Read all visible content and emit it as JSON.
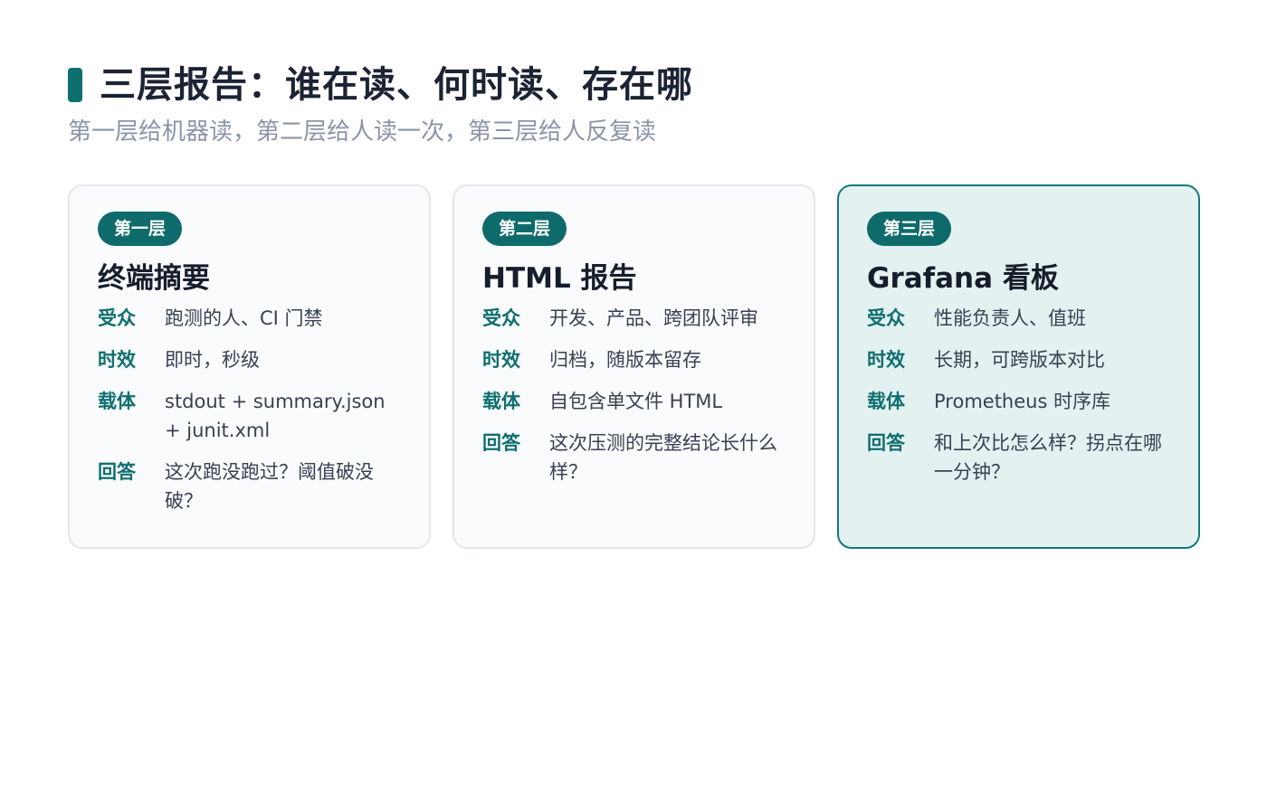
{
  "header": {
    "title": "三层报告：谁在读、何时读、存在哪",
    "subtitle": "第一层给机器读，第二层给人读一次，第三层给人反复读"
  },
  "cards": [
    {
      "badge": "第一层",
      "title": "终端摘要",
      "rows": [
        {
          "label": "受众",
          "value": "跑测的人、CI 门禁"
        },
        {
          "label": "时效",
          "value": "即时，秒级"
        },
        {
          "label": "载体",
          "value": "stdout + summary.json + junit.xml"
        },
        {
          "label": "回答",
          "value": "这次跑没跑过？阈值破没破？"
        }
      ]
    },
    {
      "badge": "第二层",
      "title": "HTML 报告",
      "rows": [
        {
          "label": "受众",
          "value": "开发、产品、跨团队评审"
        },
        {
          "label": "时效",
          "value": "归档，随版本留存"
        },
        {
          "label": "载体",
          "value": "自包含单文件 HTML"
        },
        {
          "label": "回答",
          "value": "这次压测的完整结论长什么样？"
        }
      ]
    },
    {
      "badge": "第三层",
      "title": "Grafana 看板",
      "rows": [
        {
          "label": "受众",
          "value": "性能负责人、值班"
        },
        {
          "label": "时效",
          "value": "长期，可跨版本对比"
        },
        {
          "label": "载体",
          "value": "Prometheus 时序库"
        },
        {
          "label": "回答",
          "value": "和上次比怎么样？拐点在哪一分钟？"
        }
      ]
    }
  ]
}
